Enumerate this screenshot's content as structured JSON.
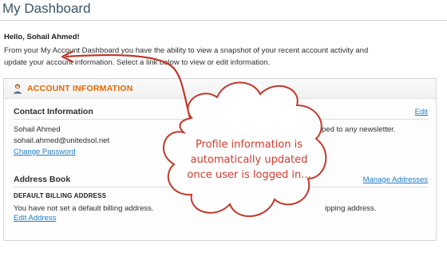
{
  "page": {
    "title": "My Dashboard"
  },
  "welcome": {
    "greeting": "Hello, Sohail Ahmed!",
    "intro": "From your My Account Dashboard you have the ability to view a snapshot of your recent account activity and update your account information. Select a link below to view or edit information."
  },
  "account": {
    "heading": "ACCOUNT INFORMATION",
    "contact": {
      "title": "Contact Information",
      "edit_label": "Edit",
      "name": "Sohail Ahmed",
      "email": "sohail.ahmed@unitedsol.net",
      "change_password": "Change Password",
      "newsletter_fragment": "ped to any newsletter."
    },
    "address_book": {
      "title": "Address Book",
      "manage_label": "Manage Addresses",
      "billing_title": "DEFAULT BILLING ADDRESS",
      "billing_text": "You have not set a default billing address.",
      "edit_address": "Edit Address",
      "shipping_fragment": "ipping address."
    }
  },
  "annotation": {
    "lines": [
      "Profile information is",
      "automatically updated",
      "once user is logged in..."
    ]
  },
  "colors": {
    "accent": "#e26703",
    "link": "#1e7ec8",
    "annotation_text": "#d33a2c",
    "annotation_border": "#c0392b"
  }
}
